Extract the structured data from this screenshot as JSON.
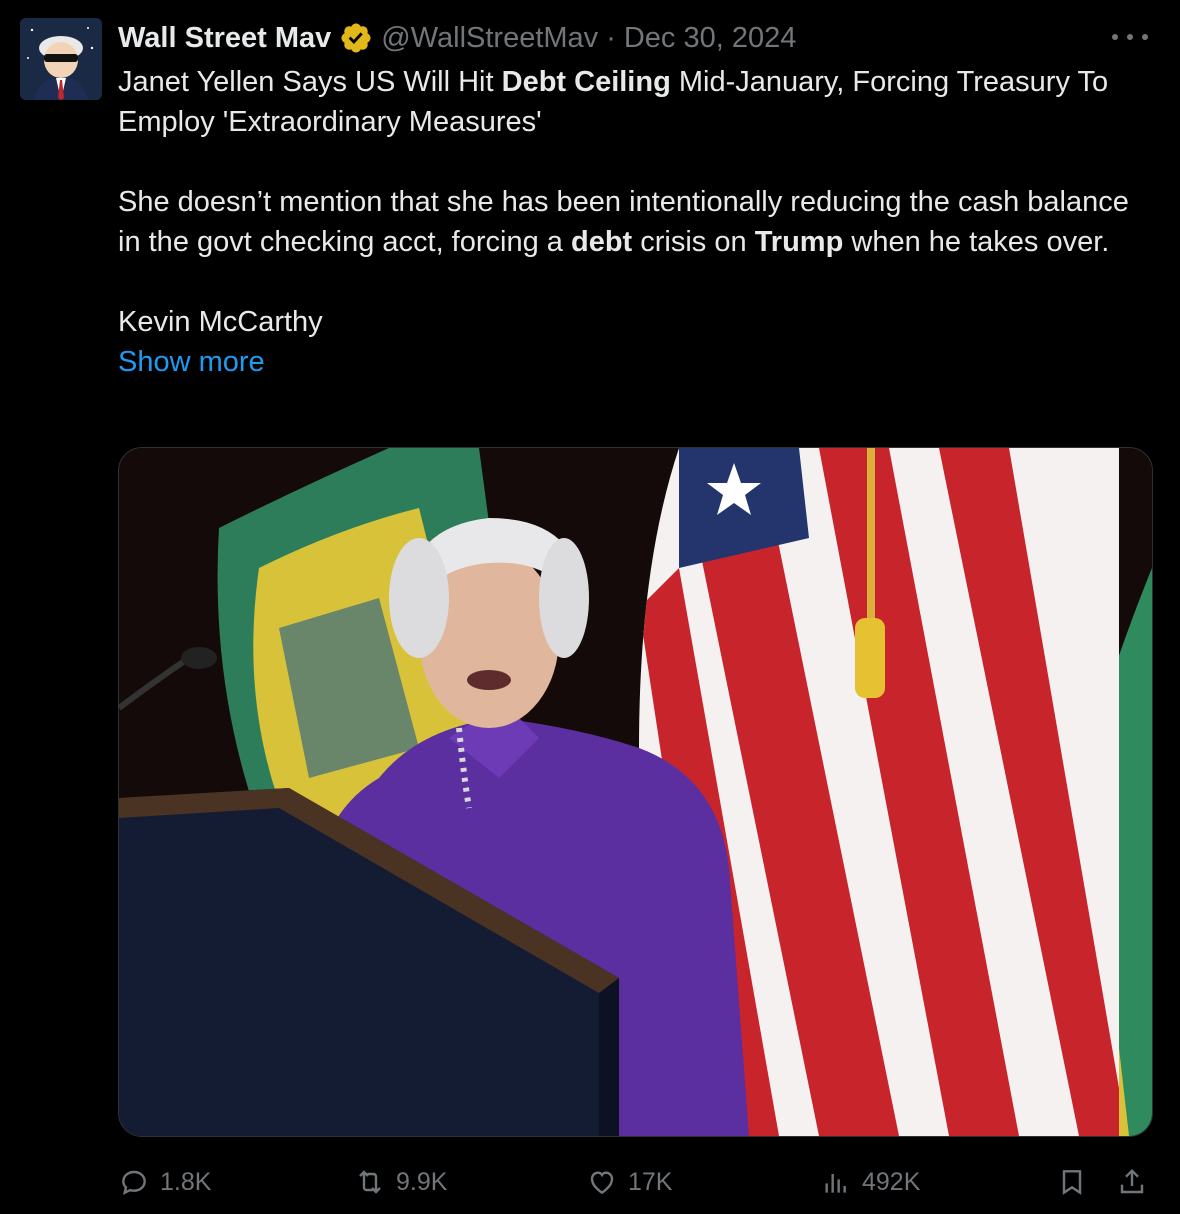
{
  "author": {
    "name": "Wall Street Mav",
    "handle": "@WallStreetMav",
    "separator": "·",
    "date": "Dec 30, 2024"
  },
  "tweet": {
    "line1_pre": "Janet Yellen Says US Will Hit ",
    "line1_bold": "Debt Ceiling",
    "line1_post": " Mid-January, Forcing Treasury To Employ 'Extraordinary Measures'",
    "para2_a": "She doesn’t mention that she has been intentionally reducing the cash balance in the govt checking acct, forcing a ",
    "para2_bold1": "debt",
    "para2_b": " crisis on ",
    "para2_bold2": "Trump",
    "para2_c": " when he takes over.",
    "para3": "Kevin McCarthy",
    "show_more": "Show more"
  },
  "actions": {
    "replies": "1.8K",
    "reposts": "9.9K",
    "likes": "17K",
    "views": "492K"
  },
  "colors": {
    "accent": "#1d9bf0",
    "muted": "#71767b",
    "verified_gold": "#e2b719"
  }
}
